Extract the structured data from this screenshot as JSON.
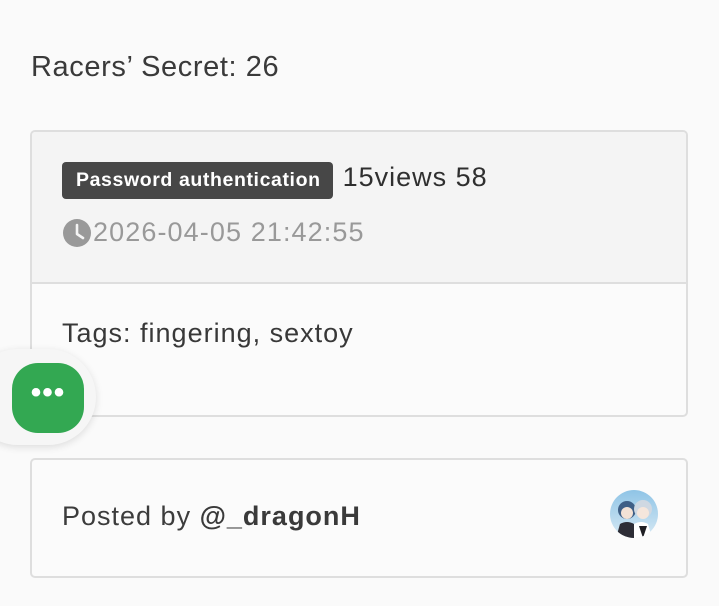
{
  "page": {
    "title": "Racers’ Secret: 26"
  },
  "post": {
    "badge": "Password authentication",
    "views": "15views 58",
    "datetime": "2026-04-05 21:42:55",
    "tags": "Tags: fingering, sextoy"
  },
  "author": {
    "posted_by_prefix": "Posted by ",
    "handle": "@_dragonH"
  },
  "fab": {
    "label": "•••"
  },
  "icons": {
    "date": "clock-icon",
    "fab": "more-dots-icon",
    "avatar": "user-avatar"
  },
  "colors": {
    "fab": "#33a852",
    "badge": "#474747",
    "muted_text": "#999999"
  }
}
